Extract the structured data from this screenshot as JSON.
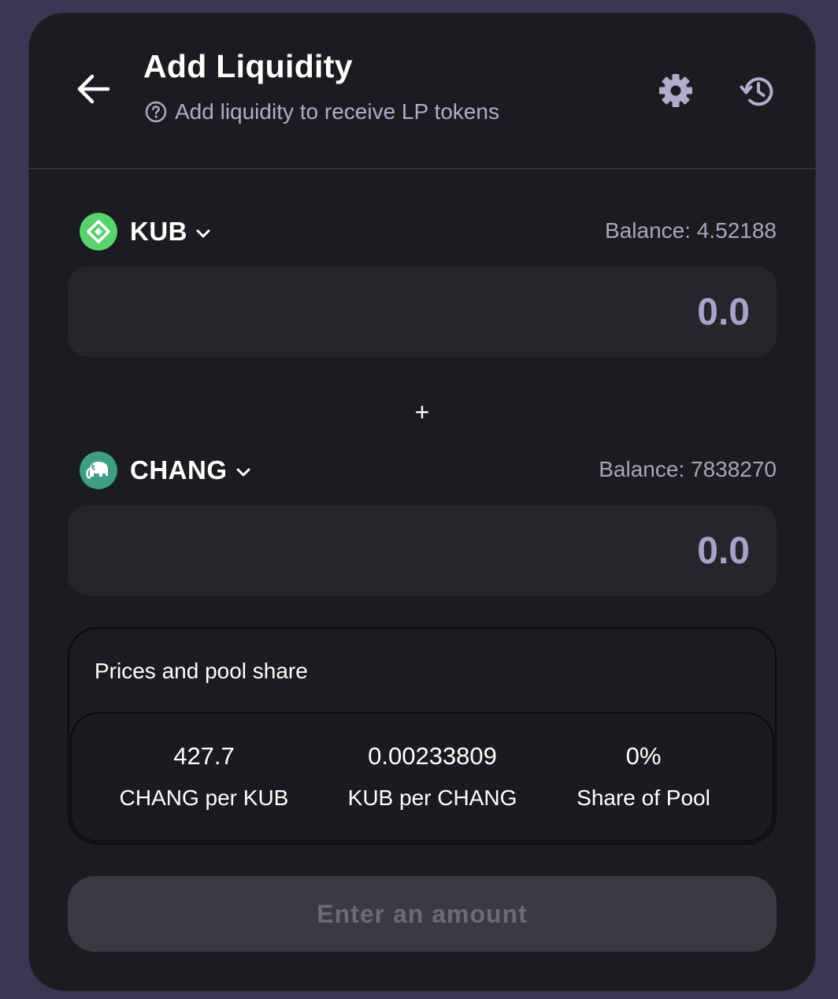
{
  "header": {
    "title": "Add Liquidity",
    "subtitle": "Add liquidity to receive LP tokens"
  },
  "token_a": {
    "symbol": "KUB",
    "balance": "Balance: 4.52188",
    "amount_placeholder": "0.0",
    "logo_color": "#5ad26e"
  },
  "plus_symbol": "+",
  "token_b": {
    "symbol": "CHANG",
    "balance": "Balance: 7838270",
    "amount_placeholder": "0.0",
    "logo_color": "#3f9e82"
  },
  "prices": {
    "title": "Prices and pool share",
    "stats": [
      {
        "value": "427.7",
        "label": "CHANG per KUB"
      },
      {
        "value": "0.00233809",
        "label": "KUB per CHANG"
      },
      {
        "value": "0%",
        "label": "Share of Pool"
      }
    ]
  },
  "submit": {
    "label": "Enter an amount"
  },
  "colors": {
    "background": "#3a3654",
    "card": "#1b1c20",
    "input_bg": "#25262b",
    "accent_text": "#a9a1c8",
    "button_disabled": "#3b3a43"
  }
}
